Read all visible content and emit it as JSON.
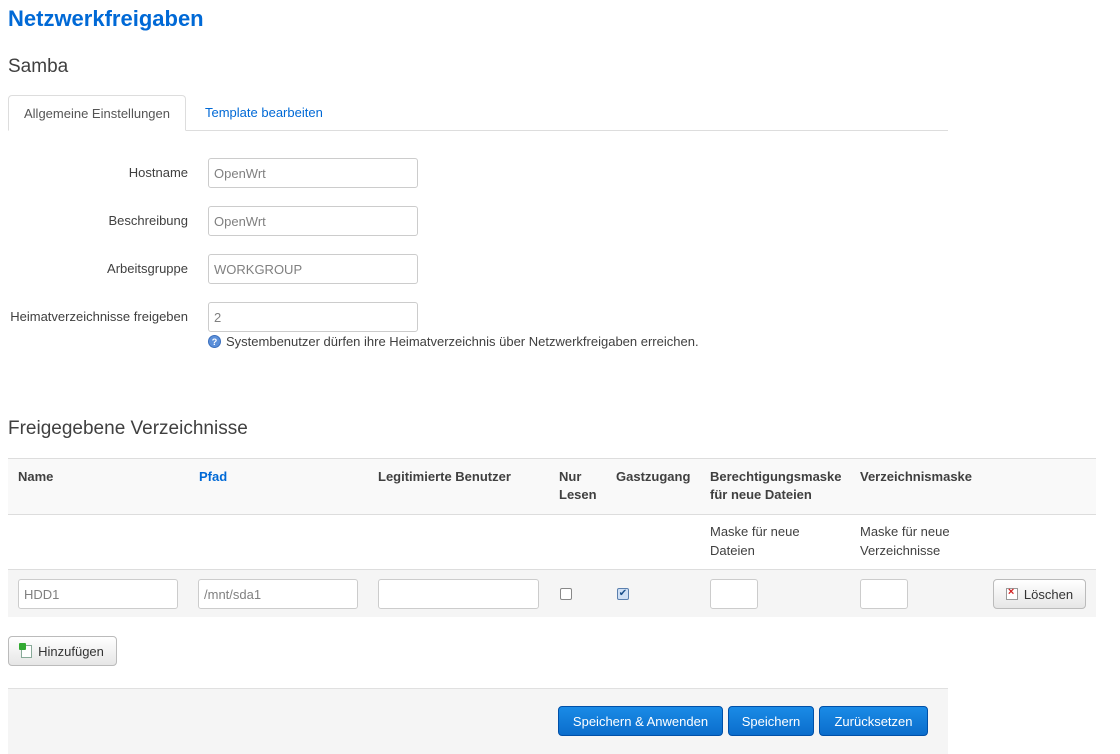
{
  "page": {
    "title": "Netzwerkfreigaben"
  },
  "samba": {
    "title": "Samba",
    "tabs": [
      {
        "label": "Allgemeine Einstellungen",
        "active": true
      },
      {
        "label": "Template bearbeiten",
        "active": false
      }
    ],
    "fields": {
      "hostname": {
        "label": "Hostname",
        "value": "OpenWrt"
      },
      "description": {
        "label": "Beschreibung",
        "value": "OpenWrt"
      },
      "workgroup": {
        "label": "Arbeitsgruppe",
        "value": "WORKGROUP"
      },
      "homes": {
        "label": "Heimatverzeichnisse freigeben",
        "value": "2",
        "help": "Systembenutzer dürfen ihre Heimatverzeichnis über Netzwerkfreigaben erreichen."
      }
    }
  },
  "shares": {
    "title": "Freigegebene Verzeichnisse",
    "headers": {
      "name": "Name",
      "path": "Pfad",
      "users": "Legitimierte Benutzer",
      "readonly_1": "Nur",
      "readonly_2": "Lesen",
      "guest": "Gastzugang",
      "create_mask_1": "Berechtigungsmaske",
      "create_mask_2": "für neue Dateien",
      "dir_mask": "Verzeichnismaske"
    },
    "hints": {
      "create_mask_1": "Maske für neue",
      "create_mask_2": "Dateien",
      "dir_mask_1": "Maske für neue",
      "dir_mask_2": "Verzeichnisse"
    },
    "rows": [
      {
        "name": "HDD1",
        "path": "/mnt/sda1",
        "users": "",
        "read_only": false,
        "guest_ok": true,
        "create_mask": "",
        "dir_mask": "",
        "delete_label": "Löschen"
      }
    ],
    "add_label": "Hinzufügen"
  },
  "actions": {
    "save_apply": "Speichern & Anwenden",
    "save": "Speichern",
    "reset": "Zurücksetzen"
  },
  "colors": {
    "accent": "#0069d6",
    "primary_button": "#0b6dcc"
  },
  "icons": {
    "help": "help-icon",
    "delete": "delete-icon",
    "add": "add-icon"
  }
}
